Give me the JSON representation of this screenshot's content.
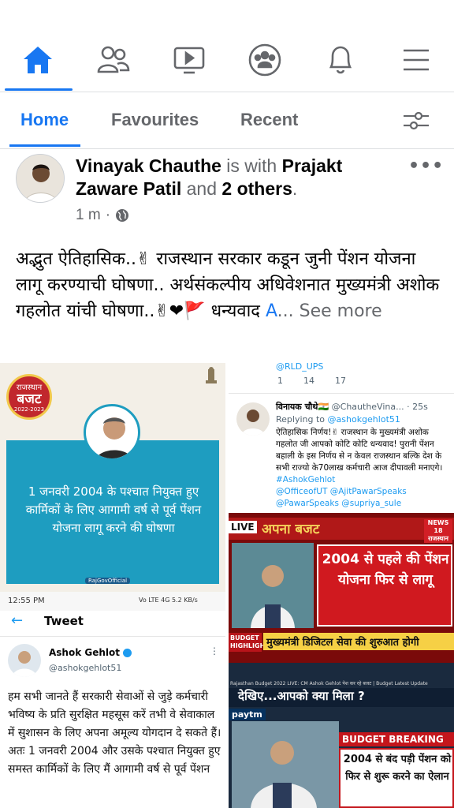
{
  "nav": {
    "icons": [
      "home-icon",
      "friends-icon",
      "watch-icon",
      "groups-icon",
      "notifications-icon",
      "menu-icon"
    ]
  },
  "feed_tabs": {
    "home": "Home",
    "favourites": "Favourites",
    "recent": "Recent"
  },
  "post": {
    "author": "Vinayak Chauthe",
    "with_text": " is with ",
    "tagged": "Prajakt Zaware Patil",
    "and_text": " and ",
    "others": "2 others",
    "period": ".",
    "time": "1 m",
    "dot": "·",
    "text": "अद्भुत ऐतिहासिक..✌ राजस्थान सरकार कडून जुनी पेंशन योजना लागू करण्याची घोषणा.. अर्थसंकल्पीय अधिवेशनात मुख्यमंत्री अशोक गहलोत यांची घोषणा..✌❤🚩 धन्यवाद ",
    "text_tail": "A",
    "see_more": "... See more"
  },
  "images": {
    "budget_badge_top": "राजस्थान",
    "budget_badge_main": "बजट",
    "budget_badge_year": "2022-2023",
    "budget_text": "1 जनवरी 2004 के पश्चात नियुक्त हुए कार्मिकों के लिए आगामी वर्ष से पूर्व पेंशन योजना लागू करने की घोषणा",
    "budget_footer": "RajGovOfficial",
    "tweet_top_handle": "@RLD_UPS",
    "tweet_top_stats": [
      "1",
      "14",
      "17"
    ],
    "tweet2_name": "विनायक चौथे🇮🇳",
    "tweet2_handle": "@ChautheVina...",
    "tweet2_time": "· 25s",
    "tweet2_reply": "Replying to",
    "tweet2_reply_handle": "@ashokgehlot51",
    "tweet2_text": "ऐतिहासिक निर्णय!✌ राजस्थान के मुख्यमंत्री अशोक गहलोत जी आपको कोटि कोटि धन्यवाद! पुरानी पेंशन बहाली के इस निर्णय से न केवल राजस्थान बल्कि देश के सभी राज्यो के70लाख कर्मचारी आज दीपावली मनाएगे।",
    "tweet2_tag": "#AshokGehlot",
    "tweet2_mentions": "@OfficeofUT @AjitPawarSpeaks",
    "tweet2_cut": "@PawarSpeaks @supriya_sule",
    "news1_live": "LIVE",
    "news1_show": "अपना बजट",
    "news1_logo": "NEWS 18 राजस्थान",
    "news1_headline": "2004 से पहले की पेंशन योजना फिर से लागू",
    "news1_ticker_label": "BUDGET HIGHLIGHTS",
    "news1_ticker": "मुख्यमंत्री डिजिटल सेवा की शुरुआत होगी",
    "status_time": "12:55 PM",
    "status_icons": "Vo LTE 4G 5.2 KB/s",
    "tweet_screen_title": "Tweet",
    "tweet_name": "Ashok Gehlot",
    "tweet_handle": "@ashokgehlot51",
    "tweet_text": "हम सभी जानते हैं सरकारी सेवाओं से जुड़े कर्मचारी भविष्य के प्रति सुरक्षित महसूस करें तभी वे सेवाकाल में सुशासन के लिए अपना अमूल्य योगदान दे सकते हैं।अतः 1 जनवरी 2004 और उसके पश्चात नियुक्त हुए समस्त कार्मिकों के लिए मैं आगामी वर्ष से पूर्व पेंशन",
    "news2_top": "Rajasthan Budget 2022 LIVE: CM Ashok Gehlot पेश कर रहे बजट | Budget Latest Update",
    "news2_show": "देखिए...आपको क्या मिला ?",
    "news2_sponsor": "paytm",
    "news2_breaking": "BUDGET BREAKING",
    "news2_headline": "2004 से बंद पड़ी पेंशन को फिर से शुरू करने का ऐलान"
  },
  "colors": {
    "accent": "#1877f2",
    "muted": "#65676b",
    "budget_teal": "#1e9dc0",
    "news_red": "#c4161c"
  }
}
